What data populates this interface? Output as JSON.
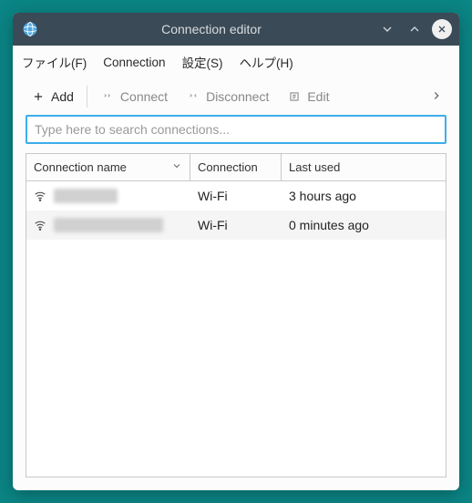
{
  "titlebar": {
    "title": "Connection editor"
  },
  "menubar": {
    "items": [
      {
        "label": "ファイル(F)"
      },
      {
        "label": "Connection"
      },
      {
        "label": "設定(S)"
      },
      {
        "label": "ヘルプ(H)"
      }
    ]
  },
  "toolbar": {
    "add": "Add",
    "connect": "Connect",
    "disconnect": "Disconnect",
    "edit": "Edit"
  },
  "search": {
    "placeholder": "Type here to search connections..."
  },
  "table": {
    "headers": {
      "name": "Connection name",
      "connection": "Connection",
      "lastused": "Last used"
    },
    "rows": [
      {
        "name_redacted_width": 70,
        "connection": "Wi-Fi",
        "lastused": "3 hours ago"
      },
      {
        "name_redacted_width": 120,
        "connection": "Wi-Fi",
        "lastused": "0 minutes ago"
      }
    ]
  }
}
